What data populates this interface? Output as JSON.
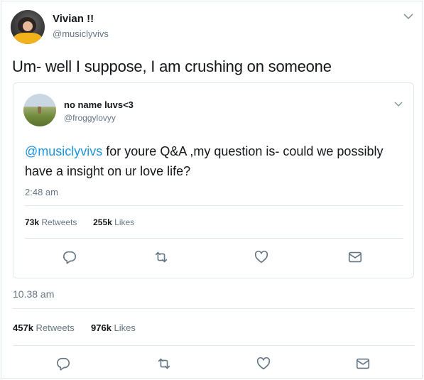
{
  "tweet": {
    "author_name": "Vivian !!",
    "author_handle": "@musiclyvivs",
    "text": "Um- well I suppose, I am crushing on someone",
    "time": "10.38 am",
    "retweets_count": "457k",
    "retweets_label": "Retweets",
    "likes_count": "976k",
    "likes_label": "Likes"
  },
  "quoted": {
    "author_name": "no name luvs<3",
    "author_handle": "@froggylovyy",
    "mention": "@musiclyvivs",
    "text": " for youre Q&A ,my question is- could we possibly have a insight on ur love life?",
    "time": "2:48 am",
    "retweets_count": "73k",
    "retweets_label": "Retweets",
    "likes_count": "255k",
    "likes_label": "Likes"
  },
  "icons": {
    "menu": "chevron-down-icon",
    "reply": "reply-icon",
    "retweet": "retweet-icon",
    "like": "heart-icon",
    "dm": "envelope-icon"
  },
  "colors": {
    "link": "#1b95e0",
    "muted": "#657786",
    "icon": "#657786",
    "border": "#e1e8ed"
  }
}
